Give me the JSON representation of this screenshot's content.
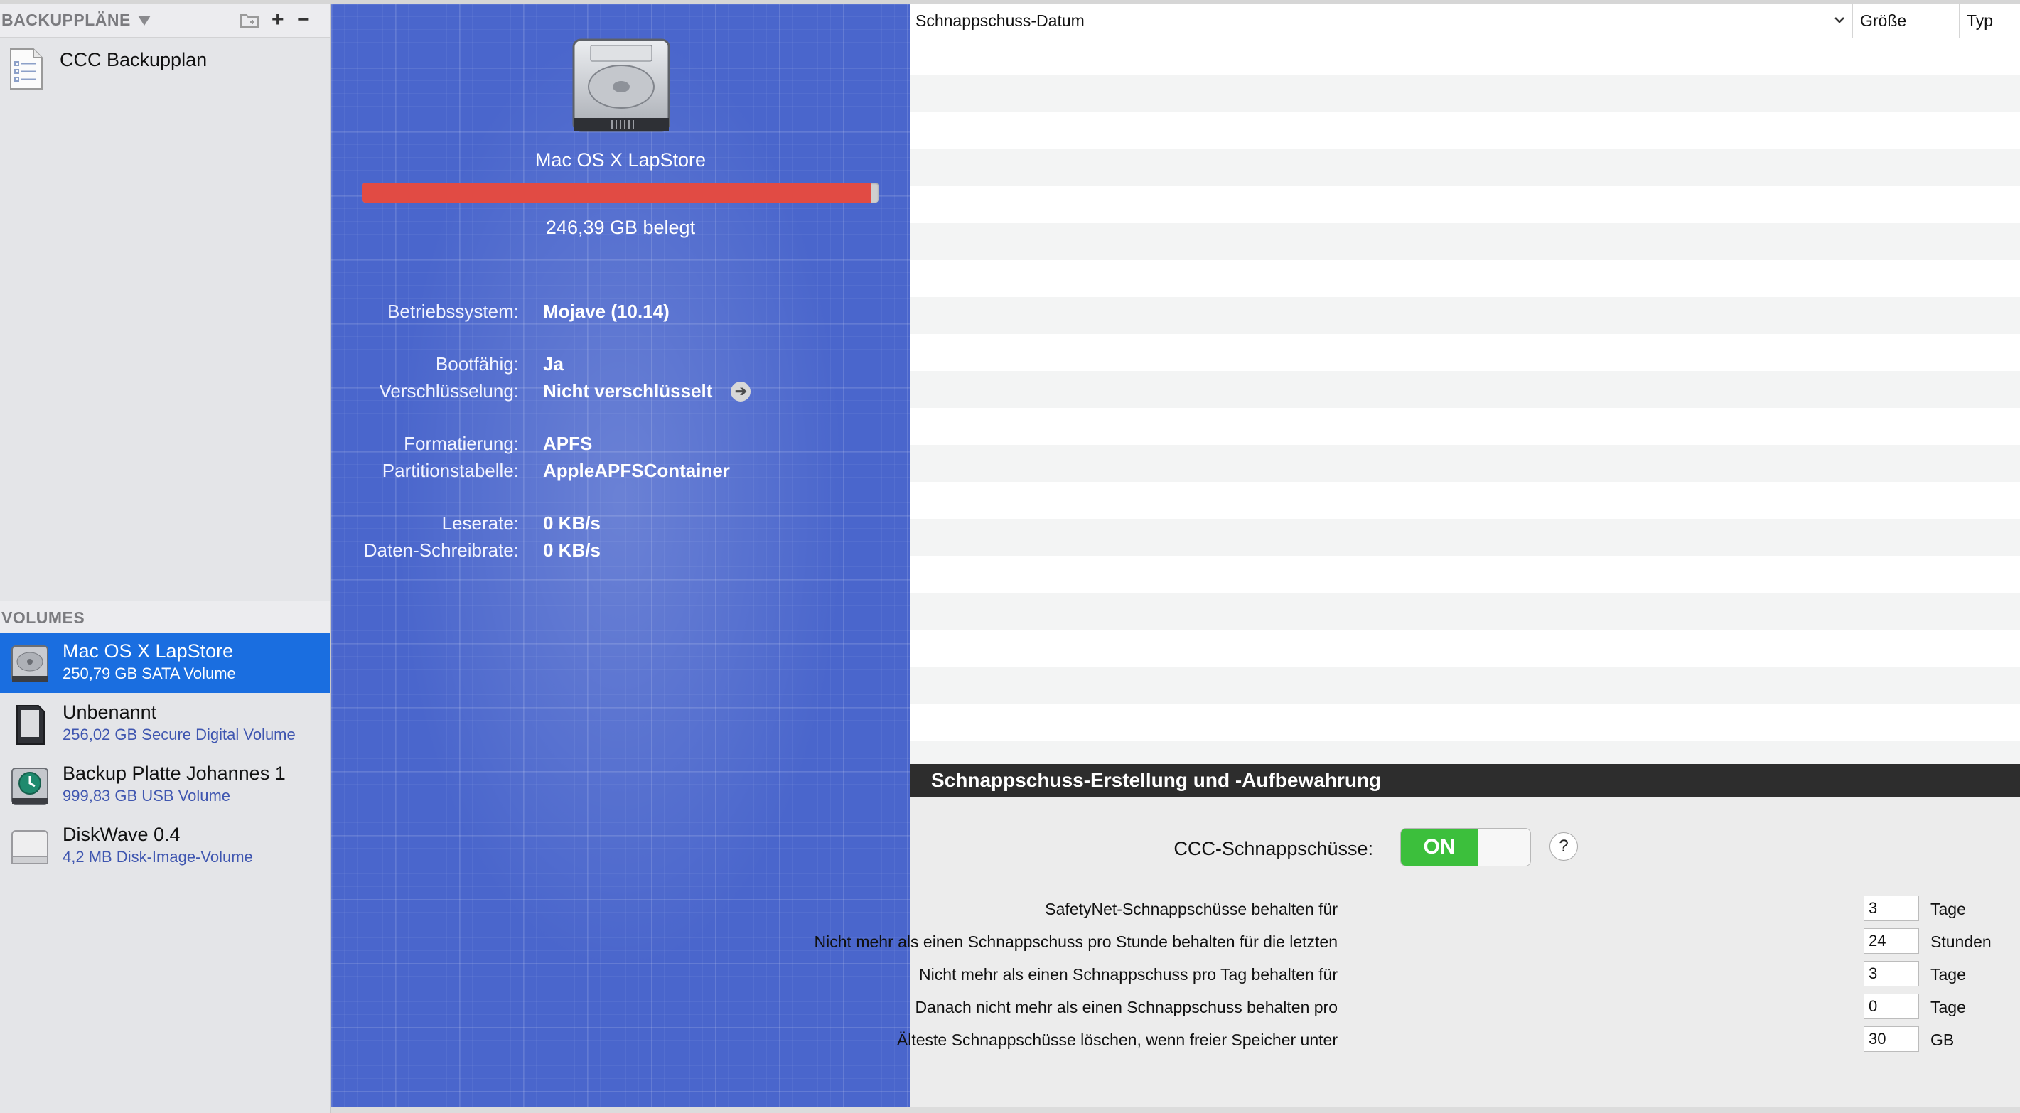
{
  "sidebar": {
    "plans_header": "BACKUPPLÄNE",
    "plans": [
      {
        "label": "CCC Backupplan",
        "icon": "document-list-icon"
      }
    ],
    "volumes_header": "VOLUMES",
    "volumes": [
      {
        "name": "Mac OS X LapStore",
        "sub": "250,79 GB SATA Volume",
        "icon": "hard-drive-icon",
        "selected": true
      },
      {
        "name": "Unbenannt",
        "sub": "256,02 GB Secure Digital Volume",
        "icon": "sd-card-icon",
        "selected": false
      },
      {
        "name": "Backup Platte Johannes 1",
        "sub": "999,83 GB USB Volume",
        "icon": "time-machine-drive-icon",
        "selected": false
      },
      {
        "name": "DiskWave 0.4",
        "sub": "4,2 MB Disk-Image-Volume",
        "icon": "disk-image-icon",
        "selected": false
      }
    ]
  },
  "volume_info": {
    "title": "Mac OS X LapStore",
    "usage_fraction": 0.985,
    "usage_text": "246,39 GB belegt",
    "rows": [
      {
        "label": "Betriebssystem:",
        "value": "Mojave (10.14)"
      },
      {
        "label": "Bootfähig:",
        "value": "Ja"
      },
      {
        "label": "Verschlüsselung:",
        "value": "Nicht verschlüsselt"
      },
      {
        "label": "Formatierung:",
        "value": "APFS"
      },
      {
        "label": "Partitionstabelle:",
        "value": "AppleAPFSContainer"
      },
      {
        "label": "Leserate:",
        "value": "0 KB/s"
      },
      {
        "label": "Daten-Schreibrate:",
        "value": "0 KB/s"
      }
    ]
  },
  "table": {
    "col_date": "Schnappschuss-Datum",
    "col_size": "Größe",
    "col_type": "Typ"
  },
  "settings": {
    "header": "Schnappschuss-Erstellung und -Aufbewahrung",
    "snapshots_label": "CCC-Schnappschüsse:",
    "toggle_label": "ON",
    "help_label": "?",
    "retention": [
      {
        "label": "SafetyNet-Schnappschüsse behalten für",
        "value": "3",
        "unit": "Tage"
      },
      {
        "label": "Nicht mehr als einen Schnappschuss pro Stunde behalten für die letzten",
        "value": "24",
        "unit": "Stunden"
      },
      {
        "label": "Nicht mehr als einen Schnappschuss pro Tag behalten für",
        "value": "3",
        "unit": "Tage"
      },
      {
        "label": "Danach nicht mehr als einen Schnappschuss behalten pro",
        "value": "0",
        "unit": "Tage"
      },
      {
        "label": "Älteste Schnappschüsse löschen, wenn freier Speicher unter",
        "value": "30",
        "unit": "GB"
      }
    ]
  },
  "colors": {
    "selection": "#1a6ee0",
    "blueprint": "#4a66cc",
    "usage_bar": "#e14b44",
    "toggle_on": "#3cbf3c"
  }
}
